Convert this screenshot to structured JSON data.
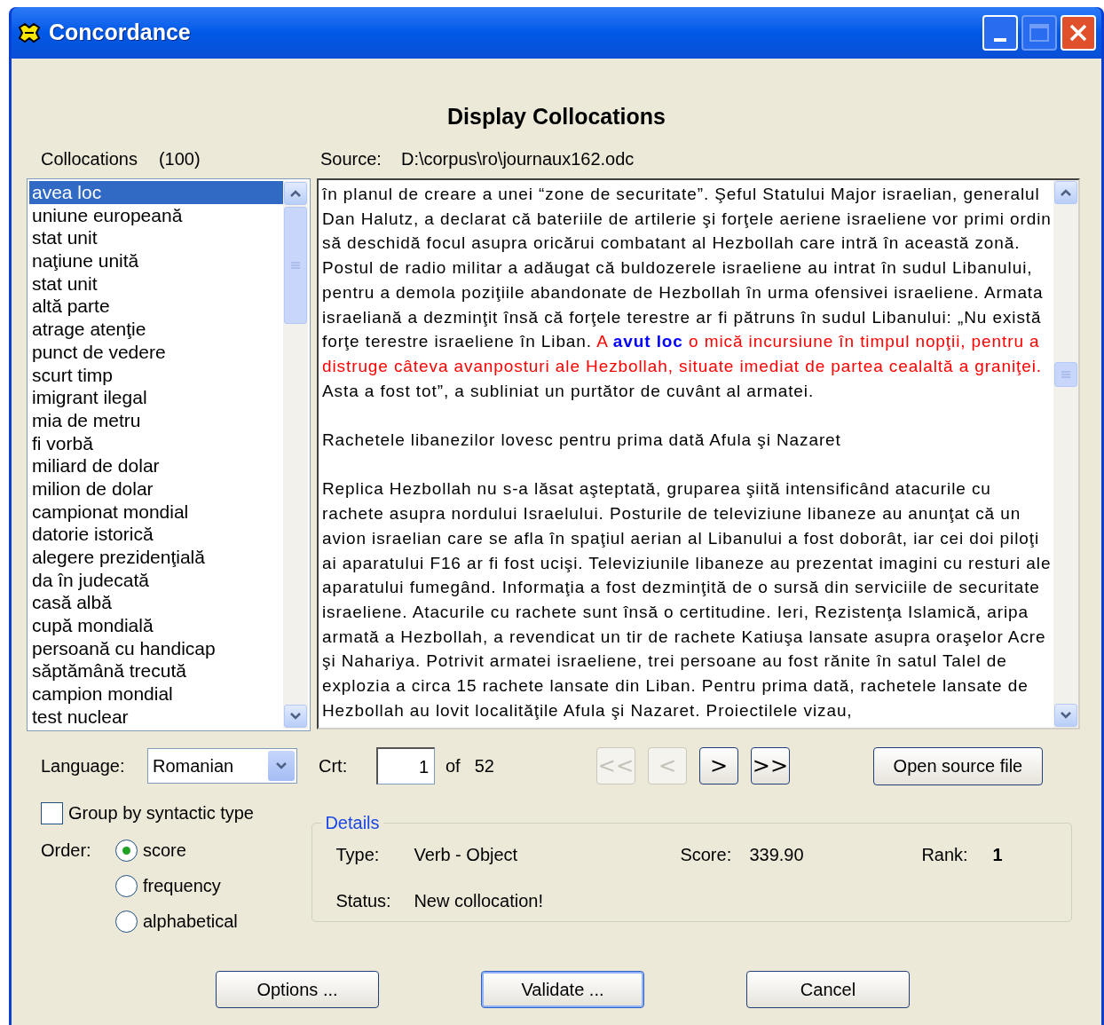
{
  "window": {
    "title": "Concordance"
  },
  "heading": "Display Collocations",
  "collocations": {
    "label": "Collocations",
    "count": "(100)",
    "items": [
      {
        "text": "avea loc",
        "selected": true
      },
      {
        "text": "uniune europeană",
        "selected": false
      },
      {
        "text": "stat unit",
        "selected": false
      },
      {
        "text": "naţiune unită",
        "selected": false
      },
      {
        "text": "stat unit",
        "selected": false
      },
      {
        "text": "altă parte",
        "selected": false
      },
      {
        "text": "atrage atenţie",
        "selected": false
      },
      {
        "text": "punct de vedere",
        "selected": false
      },
      {
        "text": "scurt timp",
        "selected": false
      },
      {
        "text": "imigrant ilegal",
        "selected": false
      },
      {
        "text": "mia de metru",
        "selected": false
      },
      {
        "text": "fi vorbă",
        "selected": false
      },
      {
        "text": "miliard de dolar",
        "selected": false
      },
      {
        "text": "milion de dolar",
        "selected": false
      },
      {
        "text": "campionat mondial",
        "selected": false
      },
      {
        "text": "datorie istorică",
        "selected": false
      },
      {
        "text": "alegere prezidenţială",
        "selected": false
      },
      {
        "text": "da în judecată",
        "selected": false
      },
      {
        "text": "casă albă",
        "selected": false
      },
      {
        "text": "cupă mondială",
        "selected": false
      },
      {
        "text": "persoană cu handicap",
        "selected": false
      },
      {
        "text": "săptămână trecută",
        "selected": false
      },
      {
        "text": "campion mondial",
        "selected": false
      },
      {
        "text": "test nuclear",
        "selected": false
      }
    ]
  },
  "source": {
    "label": "Source:",
    "path": "D:\\corpus\\ro\\journaux162.odc",
    "paragraphs": [
      {
        "segments": [
          {
            "kind": "normal",
            "text": "în planul de creare a unei “zone de securitate”. Şeful Statului Major israelian, generalul Dan Halutz, a declarat că bateriile de artilerie şi forţele aeriene israeliene vor primi ordin să deschidă focul asupra oricărui combatant al Hezbollah care intră în această zonă. Postul de radio militar a adăugat că buldozerele israeliene au intrat în sudul Libanului, pentru a demola poziţiile abandonate de Hezbollah în urma ofensivei israeliene. Armata israeliană a dezminţit însă că forţele terestre ar fi pătruns în sudul Libanului: „Nu există forţe terestre israeliene în Liban. "
          },
          {
            "kind": "context",
            "text": "A "
          },
          {
            "kind": "collocation",
            "text": "avut loc"
          },
          {
            "kind": "context",
            "text": " o mică incursiune în timpul nopţii, pentru a distruge câteva avanposturi ale Hezbollah, situate imediat de partea cealaltă a graniţei."
          },
          {
            "kind": "normal",
            "text": " Asta a fost tot”, a subliniat un purtător de cuvânt al armatei."
          }
        ]
      },
      {
        "segments": [
          {
            "kind": "normal",
            "text": "Rachetele libanezilor lovesc pentru prima dată Afula şi Nazaret"
          }
        ]
      },
      {
        "segments": [
          {
            "kind": "normal",
            "text": "Replica Hezbollah nu s-a lăsat aşteptată, gruparea şiită intensificând atacurile cu rachete asupra nordului Israelului. Posturile de televiziune libaneze au anunţat că un avion israelian care se afla în spaţiul aerian al Libanului a fost doborât, iar cei doi piloţi ai aparatului F16 ar fi fost ucişi. Televiziunile libaneze au prezentat imagini cu resturi ale aparatului fumegând. Informaţia a fost dezminţită de o sursă din serviciile de securitate israeliene. Atacurile cu rachete sunt însă o certitudine. Ieri, Rezistenţa Islamică, aripa armată a Hezbollah, a revendicat un tir de rachete Katiuşa lansate asupra oraşelor Acre şi Nahariya. Potrivit armatei israeliene, trei persoane au fost rănite în satul Talel de explozia a circa 15 rachete lansate din Liban. Pentru prima dată, rachetele lansate de Hezbollah au lovit localităţile Afula şi Nazaret. Proiectilele vizau,"
          }
        ]
      }
    ]
  },
  "language": {
    "label": "Language:",
    "value": "Romanian"
  },
  "counter": {
    "label": "Crt:",
    "value": "1",
    "of": "of",
    "total": "52"
  },
  "nav_buttons": [
    {
      "label": "<<",
      "disabled": true
    },
    {
      "label": "<",
      "disabled": true
    },
    {
      "label": ">",
      "disabled": false
    },
    {
      "label": ">>",
      "disabled": false
    }
  ],
  "open_button": "Open source file",
  "group_by": {
    "label": "Group by syntactic type",
    "checked": false
  },
  "order": {
    "label": "Order:",
    "options": [
      {
        "label": "score",
        "selected": true
      },
      {
        "label": "frequency",
        "selected": false
      },
      {
        "label": "alphabetical",
        "selected": false
      }
    ]
  },
  "details": {
    "title": "Details",
    "type_label": "Type:",
    "type_value": "Verb - Object",
    "status_label": "Status:",
    "status_value": "New collocation!",
    "score_label": "Score:",
    "score_value": "339.90",
    "rank_label": "Rank:",
    "rank_value": "1"
  },
  "buttons": [
    {
      "label": "Options ...",
      "default": false
    },
    {
      "label": "Validate ...",
      "default": true
    },
    {
      "label": "Cancel",
      "default": false
    }
  ]
}
